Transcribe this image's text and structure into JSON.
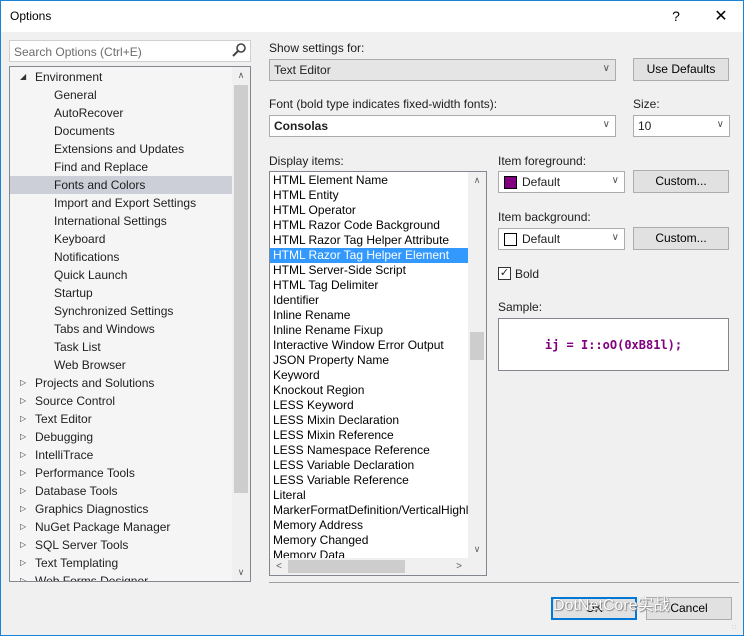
{
  "window": {
    "title": "Options",
    "help_label": "?",
    "close_label": "✕"
  },
  "search": {
    "placeholder": "Search Options (Ctrl+E)",
    "icon": "search-icon"
  },
  "tree": {
    "items": [
      {
        "label": "Environment",
        "level": 0,
        "expander": "expanded"
      },
      {
        "label": "General",
        "level": 1
      },
      {
        "label": "AutoRecover",
        "level": 1
      },
      {
        "label": "Documents",
        "level": 1
      },
      {
        "label": "Extensions and Updates",
        "level": 1
      },
      {
        "label": "Find and Replace",
        "level": 1
      },
      {
        "label": "Fonts and Colors",
        "level": 1,
        "selected": true
      },
      {
        "label": "Import and Export Settings",
        "level": 1
      },
      {
        "label": "International Settings",
        "level": 1
      },
      {
        "label": "Keyboard",
        "level": 1
      },
      {
        "label": "Notifications",
        "level": 1
      },
      {
        "label": "Quick Launch",
        "level": 1
      },
      {
        "label": "Startup",
        "level": 1
      },
      {
        "label": "Synchronized Settings",
        "level": 1
      },
      {
        "label": "Tabs and Windows",
        "level": 1
      },
      {
        "label": "Task List",
        "level": 1
      },
      {
        "label": "Web Browser",
        "level": 1
      },
      {
        "label": "Projects and Solutions",
        "level": 0,
        "expander": "collapsed"
      },
      {
        "label": "Source Control",
        "level": 0,
        "expander": "collapsed"
      },
      {
        "label": "Text Editor",
        "level": 0,
        "expander": "collapsed"
      },
      {
        "label": "Debugging",
        "level": 0,
        "expander": "collapsed"
      },
      {
        "label": "IntelliTrace",
        "level": 0,
        "expander": "collapsed"
      },
      {
        "label": "Performance Tools",
        "level": 0,
        "expander": "collapsed"
      },
      {
        "label": "Database Tools",
        "level": 0,
        "expander": "collapsed"
      },
      {
        "label": "Graphics Diagnostics",
        "level": 0,
        "expander": "collapsed"
      },
      {
        "label": "NuGet Package Manager",
        "level": 0,
        "expander": "collapsed"
      },
      {
        "label": "SQL Server Tools",
        "level": 0,
        "expander": "collapsed"
      },
      {
        "label": "Text Templating",
        "level": 0,
        "expander": "collapsed"
      },
      {
        "label": "Web Forms Designer",
        "level": 0,
        "expander": "collapsed"
      }
    ],
    "scroll_position_fraction": 0.0
  },
  "settings": {
    "show_settings_label": "Show settings for:",
    "show_settings_value": "Text Editor",
    "use_defaults_label": "Use Defaults",
    "font_label": "Font (bold type indicates fixed-width fonts):",
    "font_value": "Consolas",
    "size_label": "Size:",
    "size_value": "10",
    "display_items_label": "Display items:",
    "display_items": [
      "HTML Element Name",
      "HTML Entity",
      "HTML Operator",
      "HTML Razor Code Background",
      "HTML Razor Tag Helper Attribute",
      "HTML Razor Tag Helper Element",
      "HTML Server-Side Script",
      "HTML Tag Delimiter",
      "Identifier",
      "Inline Rename",
      "Inline Rename Fixup",
      "Interactive Window Error Output",
      "JSON Property Name",
      "Keyword",
      "Knockout Region",
      "LESS Keyword",
      "LESS Mixin Declaration",
      "LESS Mixin Reference",
      "LESS Namespace Reference",
      "LESS Variable Declaration",
      "LESS Variable Reference",
      "Literal",
      "MarkerFormatDefinition/VerticalHighlight",
      "Memory Address",
      "Memory Changed",
      "Memory Data"
    ],
    "selected_display_item": "HTML Razor Tag Helper Element",
    "item_foreground_label": "Item foreground:",
    "item_foreground_value": "Default",
    "item_foreground_color": "#800080",
    "item_background_label": "Item background:",
    "item_background_value": "Default",
    "item_background_color": "#ffffff",
    "custom_label": "Custom...",
    "bold_label": "Bold",
    "bold_checked": true,
    "sample_label": "Sample:",
    "sample_text": "ij = I::oO(0xB81l);",
    "sample_color": "#800080"
  },
  "footer": {
    "ok_label": "OK",
    "cancel_label": "Cancel",
    "watermark": "DotNetCore实战"
  },
  "colors": {
    "accent": "#0078d7",
    "selection": "#3399ff",
    "tree_selection": "#ccced8"
  }
}
